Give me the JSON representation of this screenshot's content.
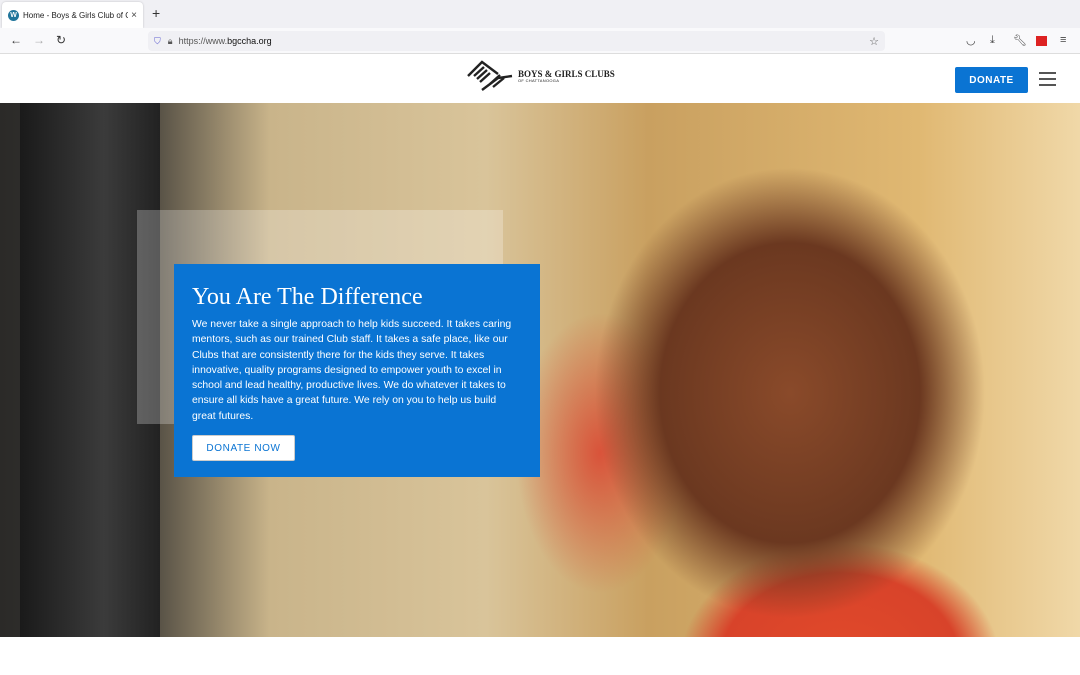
{
  "browser": {
    "tab_title": "Home - Boys & Girls Club of Chattanooga",
    "url_prefix": "https://www.",
    "url_host": "bgccha.org"
  },
  "header": {
    "logo_line1": "BOYS & GIRLS CLUBS",
    "logo_line2": "OF CHATTANOOGA",
    "donate_label": "DONATE"
  },
  "hero": {
    "title": "You Are The Difference",
    "body": "We never take a single approach to help kids succeed. It takes caring mentors, such as our trained Club staff. It takes a safe place, like our Clubs that are consistently there for the kids they serve. It takes innovative, quality programs designed to empower youth to excel in school and lead healthy, productive lives. We do whatever it takes to ensure all kids have a great future. We rely on you to help us build great futures.",
    "cta_label": "DONATE NOW"
  },
  "colors": {
    "brand_blue": "#0a74d3"
  }
}
